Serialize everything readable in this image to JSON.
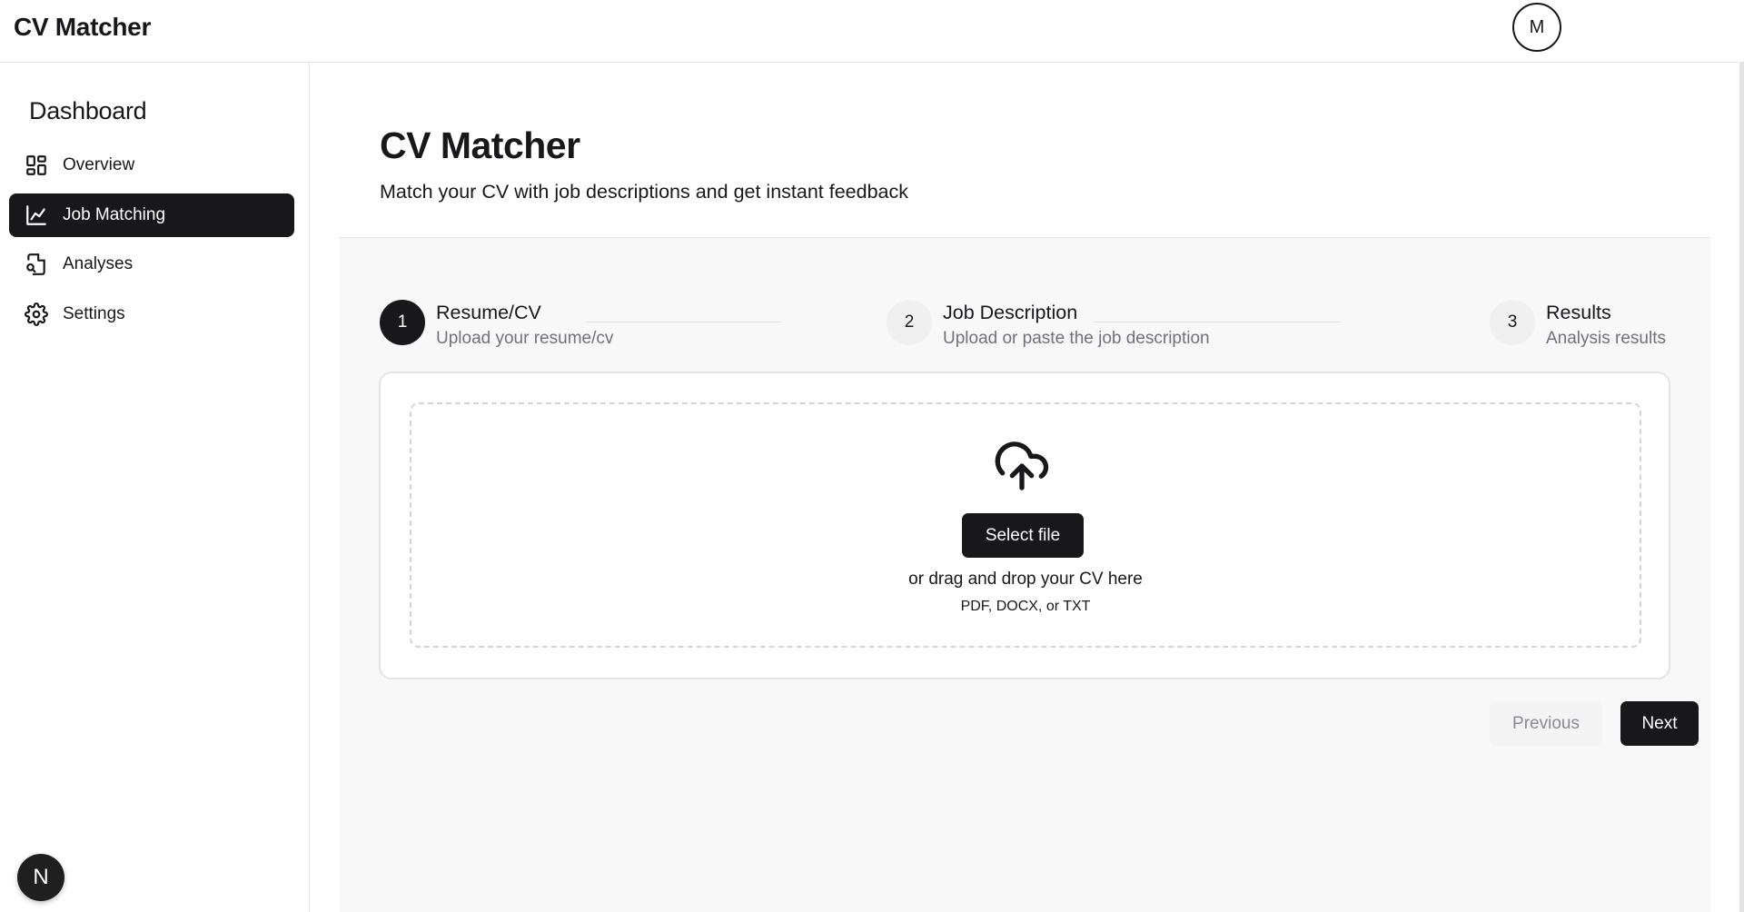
{
  "app": {
    "title": "CV Matcher",
    "user_initial": "M"
  },
  "sidebar": {
    "title": "Dashboard",
    "items": [
      {
        "label": "Overview",
        "icon": "layout-dashboard-icon",
        "active": false
      },
      {
        "label": "Job Matching",
        "icon": "line-chart-icon",
        "active": true
      },
      {
        "label": "Analyses",
        "icon": "file-search-icon",
        "active": false
      },
      {
        "label": "Settings",
        "icon": "gear-icon",
        "active": false
      }
    ],
    "badge_letter": "N"
  },
  "main": {
    "title": "CV Matcher",
    "subtitle": "Match your CV with job descriptions and get instant feedback",
    "steps": [
      {
        "number": "1",
        "title": "Resume/CV",
        "description": "Upload your resume/cv",
        "active": true
      },
      {
        "number": "2",
        "title": "Job Description",
        "description": "Upload or paste the job description",
        "active": false
      },
      {
        "number": "3",
        "title": "Results",
        "description": "Analysis results",
        "active": false
      }
    ],
    "upload": {
      "icon": "cloud-upload-icon",
      "button_label": "Select file",
      "drop_text": "or drag and drop your CV here",
      "formats": "PDF, DOCX, or TXT"
    },
    "nav": {
      "previous_label": "Previous",
      "next_label": "Next"
    }
  },
  "colors": {
    "primary": "#18181b",
    "muted_text": "#71717a",
    "border": "#e4e4e7",
    "panel_bg": "#f8f8f9",
    "disabled_text": "#8a8a92"
  }
}
